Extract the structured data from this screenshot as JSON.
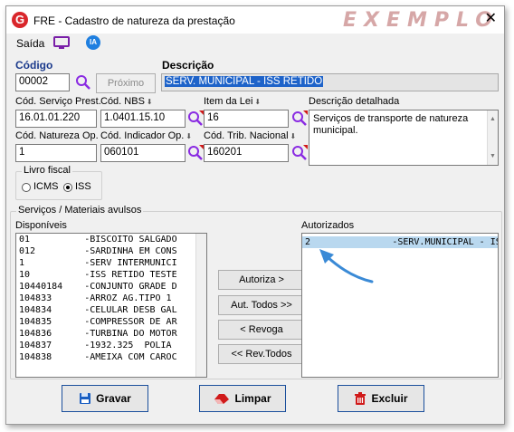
{
  "window": {
    "title": "FRE - Cadastro de natureza da prestação",
    "watermark": "EXEMPLO",
    "close_glyph": "✕",
    "logo_letter": "G"
  },
  "menu": {
    "saida": "Saída",
    "ia": "IA"
  },
  "codigo": {
    "label": "Código",
    "value": "00002",
    "next_button": "Próximo"
  },
  "descricao": {
    "label": "Descrição",
    "value": "SERV. MUNICIPAL - ISS RETIDO"
  },
  "fields": {
    "cod_servico_prest": {
      "label": "Cód. Serviço Prest.",
      "value": "16.01.01.220"
    },
    "cod_nbs": {
      "label": "Cód. NBS",
      "value": "1.0401.15.10"
    },
    "item_da_lei": {
      "label": "Item da Lei",
      "value": "16"
    },
    "descricao_detalhada": {
      "label": "Descrição detalhada",
      "value": "Serviços de transporte de natureza municipal."
    },
    "cod_natureza_op": {
      "label": "Cód. Natureza Op.",
      "value": "1"
    },
    "cod_indicador_op": {
      "label": "Cód. Indicador Op.",
      "value": "060101"
    },
    "cod_trib_nacional": {
      "label": "Cód. Trib. Nacional",
      "value": "160201"
    }
  },
  "livro_fiscal": {
    "label": "Livro fiscal",
    "icms": "ICMS",
    "iss": "ISS",
    "selected": "ISS"
  },
  "servicos": {
    "group_label": "Serviços  /  Materiais avulsos",
    "disponiveis_label": "Disponíveis",
    "autorizados_label": "Autorizados",
    "disponiveis": [
      "01          -BISCOITO SALGADO",
      "012         -SARDINHA EM CONS",
      "1           -SERV INTERMUNICI",
      "10          -ISS RETIDO TESTE",
      "10440184    -CONJUNTO GRADE D",
      "104833      -ARROZ AG.TIPO 1 ",
      "104834      -CELULAR DESB GAL",
      "104835      -COMPRESSOR DE AR",
      "104836      -TURBINA DO MOTOR",
      "104837      -1932.325  POLIA ",
      "104838      -AMEIXA COM CAROC"
    ],
    "autorizados": [
      "2               -SERV.MUNICIPAL - IS"
    ],
    "buttons": {
      "autoriza": "Autoriza >",
      "aut_todos": "Aut. Todos >>",
      "revoga": "< Revoga",
      "rev_todos": "<< Rev.Todos"
    }
  },
  "actions": {
    "gravar": "Gravar",
    "limpar": "Limpar",
    "excluir": "Excluir"
  },
  "colors": {
    "accent_blue": "#1b3a8c",
    "selection": "#1e63c9",
    "list_selection": "#b9d8ef",
    "delete_red": "#d01a1a"
  }
}
